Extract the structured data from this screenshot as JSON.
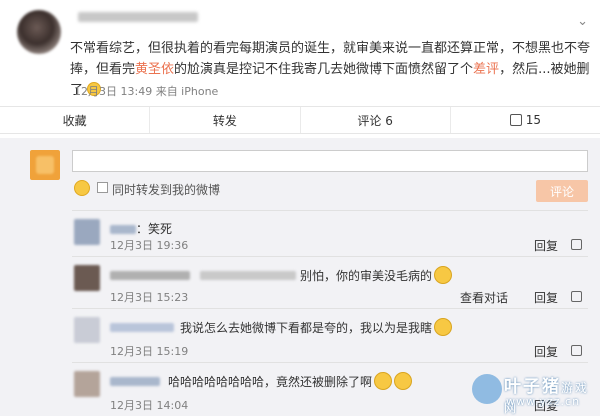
{
  "post": {
    "more_icon": "chevron-down-icon",
    "text_a": "不常看综艺，但很执着的看完每期演员的诞生，就审美来说一直都还算正常，不想黑也不夸捧，但看完",
    "text_highlight": "黄圣依",
    "text_b": "的尬演真是控记不住我寄几去她微博下面愤然留了个",
    "text_highlight2": "差评",
    "text_c": "，然后...被她删了",
    "time": "12月3日 13:49 来自 iPhone"
  },
  "actions": {
    "favorite": "收藏",
    "forward": "转发",
    "comment": "评论 6",
    "like_count": "15"
  },
  "composer": {
    "placeholder": "",
    "forward_label": "同时转发到我的微博",
    "submit_label": "评论"
  },
  "comments": [
    {
      "text": "：笑死",
      "time": "12月3日 19:36",
      "reply": "回复"
    },
    {
      "text": "别怕，你的审美没毛病的",
      "time": "12月3日 15:23",
      "dialog": "查看对话",
      "reply": "回复"
    },
    {
      "text": "我说怎么去她微博下看都是夸的，我以为是我瞎",
      "time": "12月3日 15:19",
      "reply": "回复"
    },
    {
      "text": "哈哈哈哈哈哈哈哈，竟然还被删除了啊",
      "time": "12月3日 14:04",
      "reply": "回复"
    }
  ],
  "watermark": {
    "brand": "叶子猪",
    "brand2": "游戏网",
    "url": "www.yzz.cn"
  },
  "colors": {
    "highlight": "#eb7350",
    "submit": "#f7c6a7",
    "panel": "#f2f2f5"
  }
}
